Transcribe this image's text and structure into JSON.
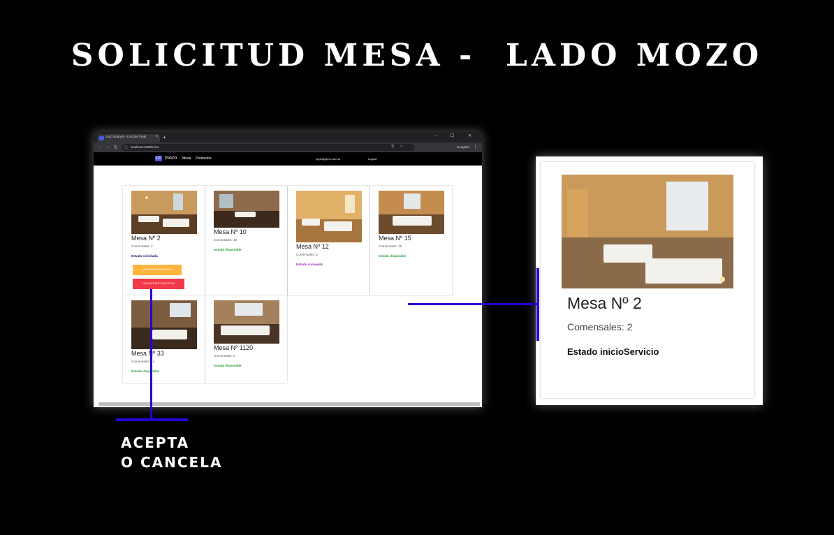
{
  "slide": {
    "title": "SOLICITUD MESA -  LADO MOZO",
    "caption_line1": "ACEPTA",
    "caption_line2": "O CANCELA"
  },
  "browser": {
    "tab_title": "La Comanda - La Gran Final",
    "tab_close": "×",
    "new_tab": "+",
    "window_controls": "– ☐ ✕",
    "url": "localhost:4200/inicio",
    "incognito_label": "Incognito",
    "menu": "⋮"
  },
  "app": {
    "logo": "LC",
    "brand": "mozo",
    "nav": [
      "Mesa",
      "Productos"
    ],
    "user_email": "pepe@pepe.com.ar",
    "logout": "Logout"
  },
  "cards": [
    {
      "title": "Mesa Nº 2",
      "comensales": "Comensales: 2",
      "estado": "Estado solicitada",
      "estado_color": "#1a237e",
      "buttons": [
        "CONFIRMAR RESERVA",
        "NO ACEPTAR SOLICITUD"
      ]
    },
    {
      "title": "Mesa Nº 10",
      "comensales": "Comensales: 10",
      "estado": "Estado disponible",
      "estado_color": "#2e9d3a"
    },
    {
      "title": "Mesa Nº 12",
      "comensales": "Comensales: 5",
      "estado": "Estado comiendo",
      "estado_color": "#9c27b0"
    },
    {
      "title": "Mesa Nº 15",
      "comensales": "Comensales: 15",
      "estado": "Estado disponible",
      "estado_color": "#2e9d3a"
    },
    {
      "title": "Mesa Nº 33",
      "comensales": "Comensales: 14",
      "estado": "Estado disponible",
      "estado_color": "#2e9d3a"
    },
    {
      "title": "Mesa Nº 1120",
      "comensales": "Comensales: 8",
      "estado": "Estado disponible",
      "estado_color": "#2e9d3a"
    }
  ],
  "button_colors": {
    "confirm": "#ffb53d",
    "reject": "#f2394a"
  },
  "zoom_card": {
    "title": "Mesa Nº 2",
    "comensales": "Comensales: 2",
    "estado": "Estado inicioServicio"
  },
  "connector_color": "#2600d6"
}
